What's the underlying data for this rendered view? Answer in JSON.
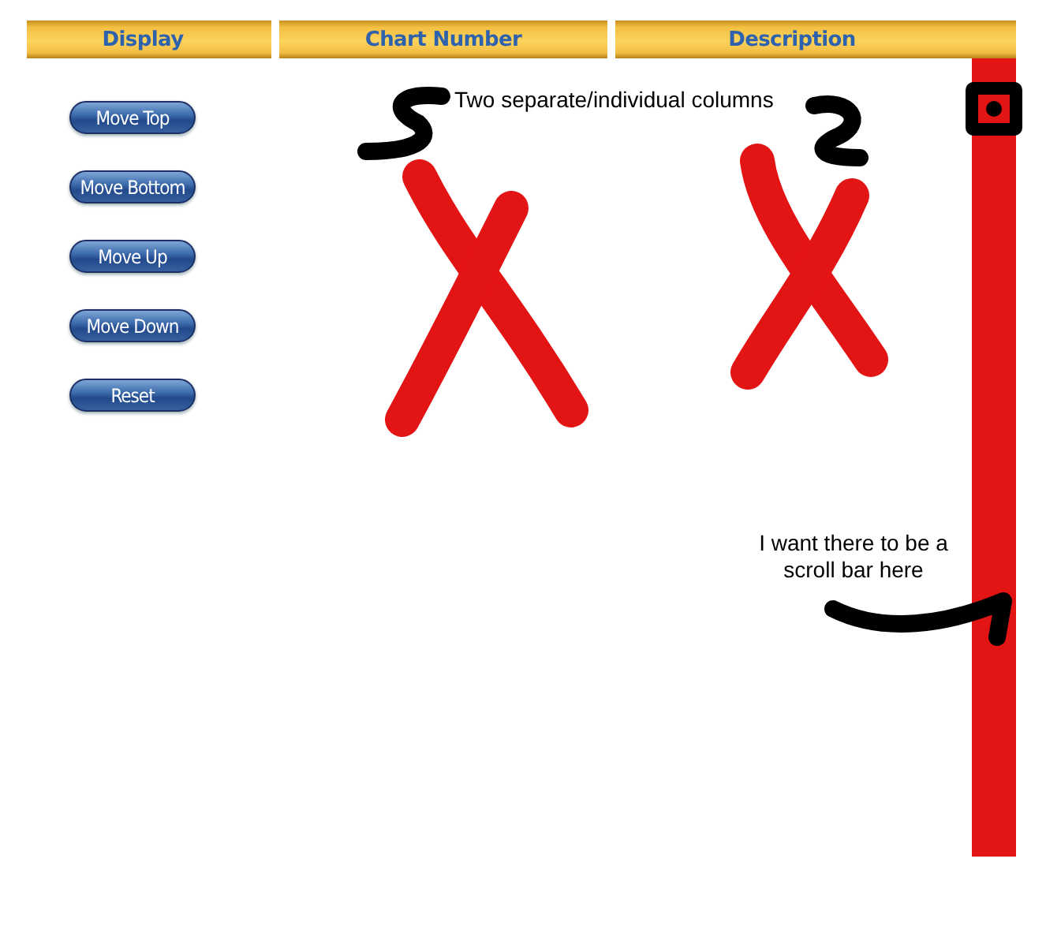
{
  "columns": [
    {
      "label": "Display"
    },
    {
      "label": "Chart Number"
    },
    {
      "label": "Description"
    }
  ],
  "buttons": [
    {
      "label": "Move Top"
    },
    {
      "label": "Move Bottom"
    },
    {
      "label": "Move Up"
    },
    {
      "label": "Move Down"
    },
    {
      "label": "Reset"
    }
  ],
  "annotations": [
    {
      "kind": "columns-note",
      "text": "Two separate/individual columns"
    },
    {
      "kind": "scroll-note",
      "text": "I want there to be a scroll bar here"
    }
  ]
}
